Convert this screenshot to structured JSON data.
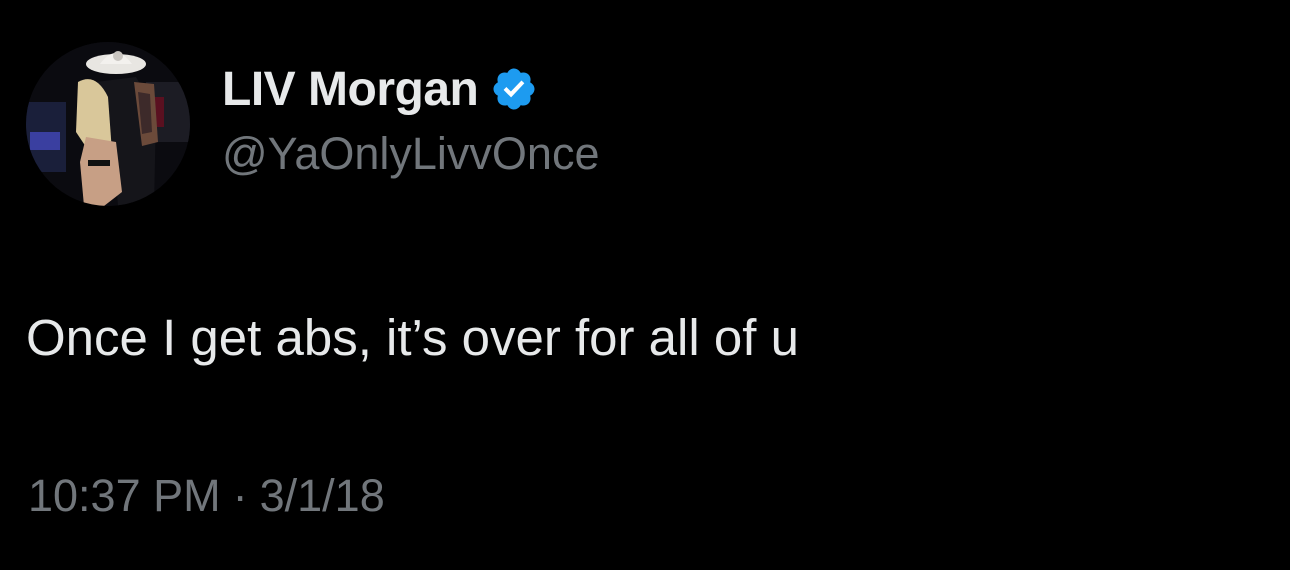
{
  "tweet": {
    "author": {
      "display_name": "LIV Morgan",
      "handle": "@YaOnlyLivvOnce",
      "verified_icon": "verified-badge-icon",
      "avatar_icon": "profile-photo"
    },
    "text": "Once I get abs, it’s over for all of u",
    "time": "10:37 PM",
    "separator": "·",
    "date": "3/1/18"
  },
  "colors": {
    "background": "#000000",
    "primary_text": "#e7e9ea",
    "secondary_text": "#71767b",
    "verified_blue": "#1d9bf0"
  }
}
